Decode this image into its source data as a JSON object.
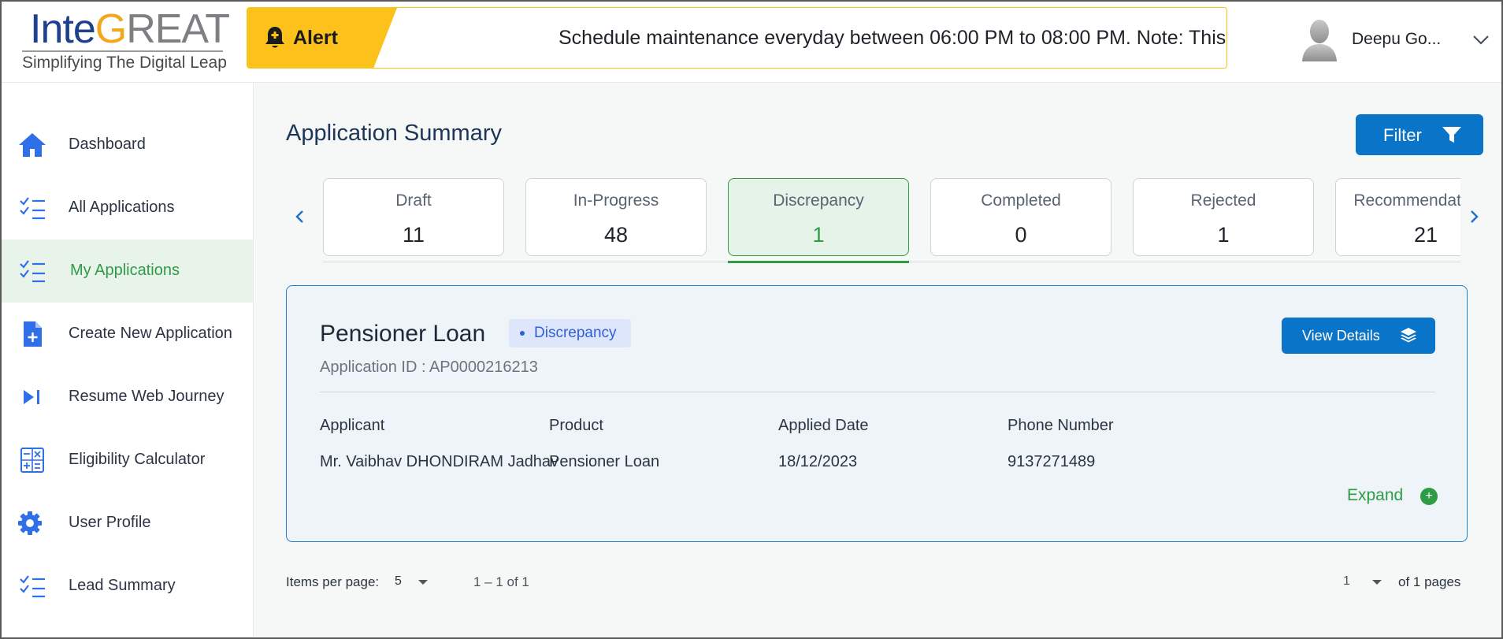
{
  "header": {
    "logo": {
      "part1": "Inte",
      "part2": "G",
      "part3": "REAT",
      "tagline": "Simplifying The Digital Leap"
    },
    "alert": {
      "label": "Alert",
      "message": "Schedule maintenance everyday between 06:00 PM to 08:00 PM. Note: This",
      "badge_color": "#fcc21b",
      "icon": "bell-icon"
    },
    "user": {
      "name": "Deepu Go...",
      "avatar_icon": "user-avatar-icon",
      "menu_icon": "chevron-down-icon"
    }
  },
  "sidebar": {
    "items": [
      {
        "label": "Dashboard",
        "icon": "home-icon",
        "active": false
      },
      {
        "label": "All Applications",
        "icon": "checklist-icon",
        "active": false
      },
      {
        "label": "My Applications",
        "icon": "checklist-icon",
        "active": true
      },
      {
        "label": "Create New Application",
        "icon": "file-add-icon",
        "active": false
      },
      {
        "label": "Resume Web Journey",
        "icon": "skip-next-icon",
        "active": false
      },
      {
        "label": "Eligibility Calculator",
        "icon": "calculator-icon",
        "active": false
      },
      {
        "label": "User Profile",
        "icon": "gear-icon",
        "active": false
      },
      {
        "label": "Lead Summary",
        "icon": "checklist-icon",
        "active": false
      }
    ],
    "active_color": "#2e9b45"
  },
  "main": {
    "title": "Application Summary",
    "filter_label": "Filter",
    "tabs": [
      {
        "label": "Draft",
        "count": "11",
        "active": false
      },
      {
        "label": "In-Progress",
        "count": "48",
        "active": false
      },
      {
        "label": "Discrepancy",
        "count": "1",
        "active": true
      },
      {
        "label": "Completed",
        "count": "0",
        "active": false
      },
      {
        "label": "Rejected",
        "count": "1",
        "active": false
      },
      {
        "label": "Recommendation A",
        "count": "21",
        "active": false
      }
    ],
    "card": {
      "title": "Pensioner Loan",
      "status_badge": "Discrepancy",
      "application_id": "Application ID : AP0000216213",
      "view_details_label": "View Details",
      "fields": [
        {
          "label": "Applicant",
          "value": "Mr. Vaibhav DHONDIRAM Jadhav"
        },
        {
          "label": "Product",
          "value": "Pensioner Loan"
        },
        {
          "label": "Applied Date",
          "value": "18/12/2023"
        },
        {
          "label": "Phone Number",
          "value": "9137271489"
        }
      ],
      "expand_label": "Expand"
    },
    "pagination": {
      "items_per_page_label": "Items per page:",
      "items_per_page_value": "5",
      "range": "1 – 1 of 1",
      "page_value": "1",
      "page_of": "of 1 pages"
    },
    "primary_color": "#0a74c9"
  }
}
